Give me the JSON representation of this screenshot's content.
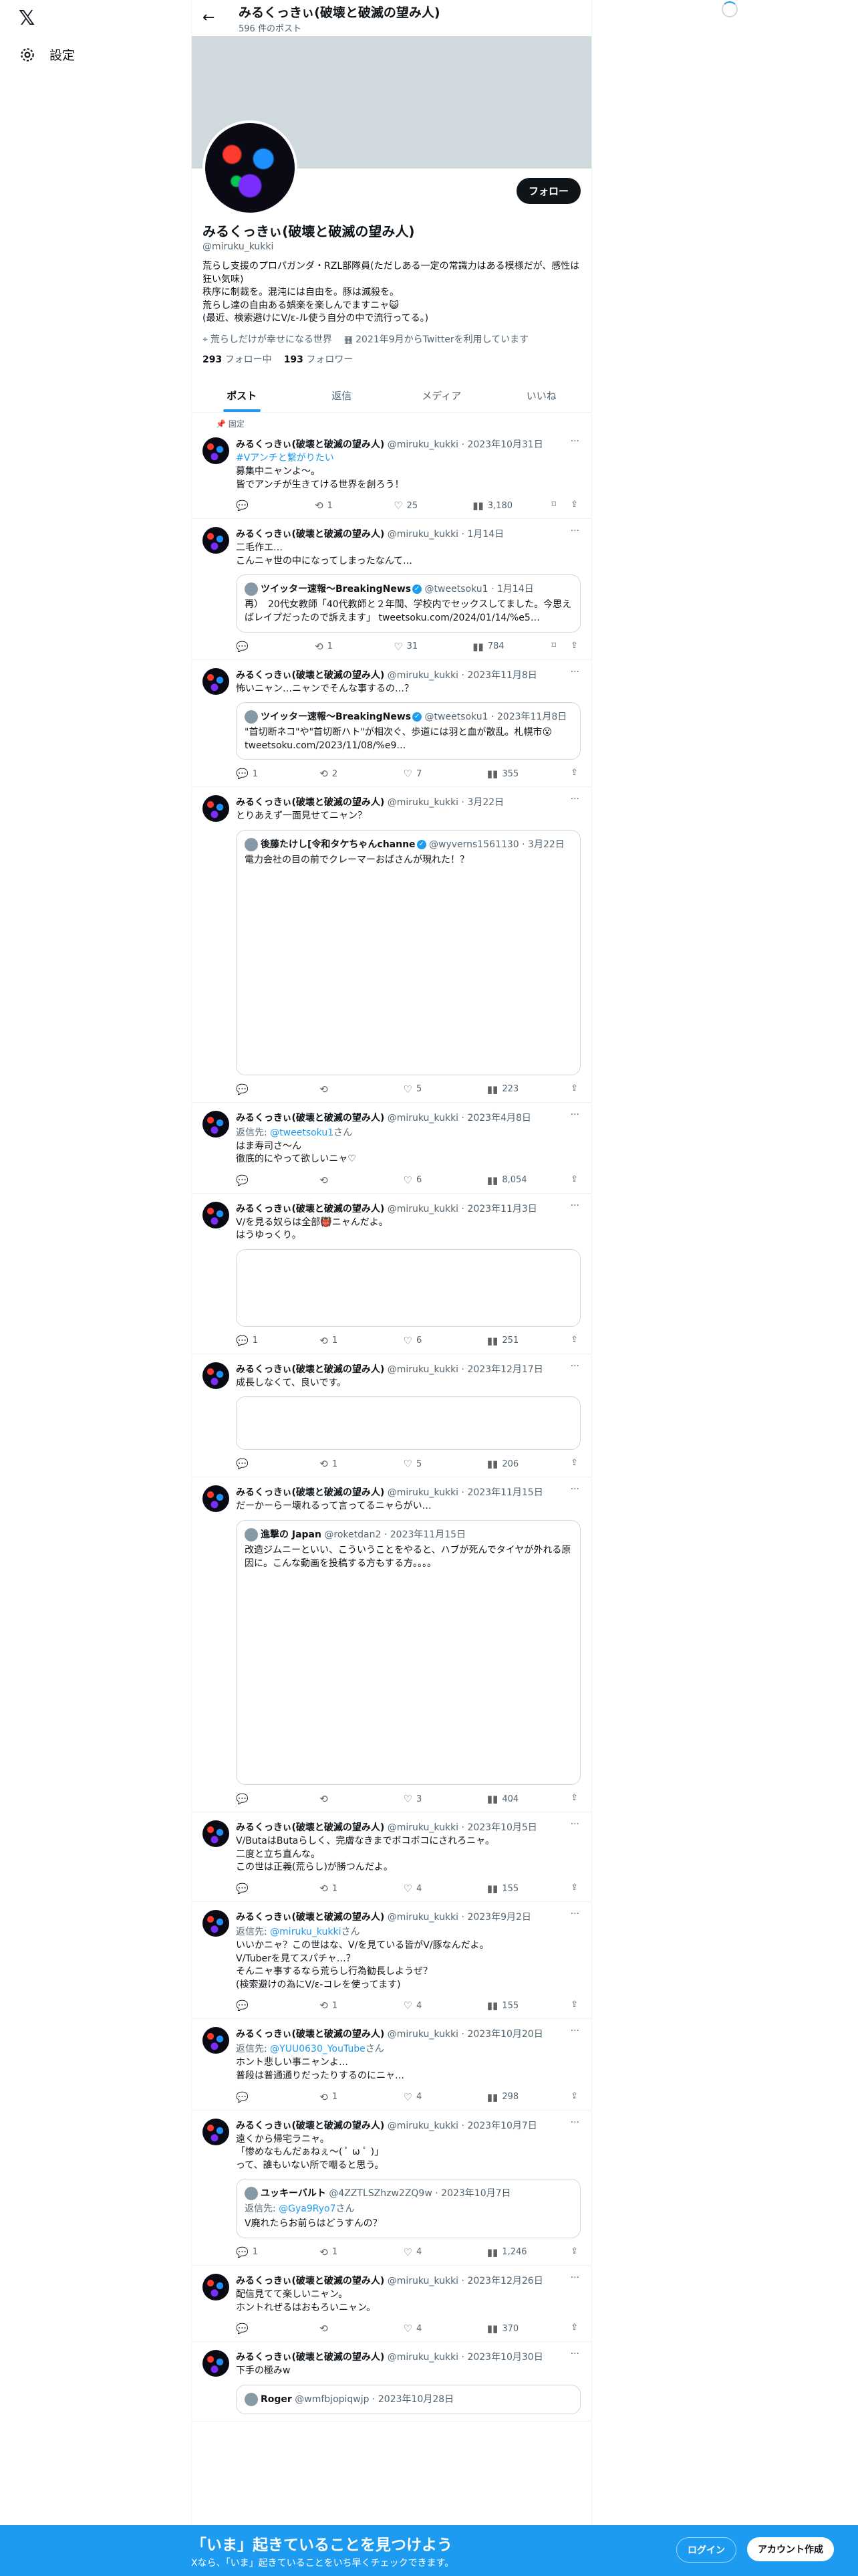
{
  "sidebar": {
    "logo": "𝕏",
    "settings_label": "設定"
  },
  "topbar": {
    "name": "みるくっきぃ(破壊と破滅の望み人)",
    "post_count": "596 件のポスト"
  },
  "profile": {
    "follow_label": "フォロー",
    "name": "みるくっきぃ(破壊と破滅の望み人)",
    "handle": "@miruku_kukki",
    "bio": "荒らし支援のプロパガンダ・RZL部隊員(ただしある一定の常識力はある模様だが、感性は狂い気味)\n秩序に制裁を。混沌には自由を。豚は滅殺を。\n荒らし達の自由ある娯楽を楽しんでますニャ😺\n(最近、検索避けにV/ε-ル使う自分の中で流行ってる。)",
    "location": "荒らしだけが幸せになる世界",
    "joined": "2021年9月からTwitterを利用しています",
    "following_count": "293",
    "following_label": "フォロー中",
    "followers_count": "193",
    "followers_label": "フォロワー"
  },
  "tabs": [
    {
      "label": "ポスト"
    },
    {
      "label": "返信"
    },
    {
      "label": "メディア"
    },
    {
      "label": "いいね"
    }
  ],
  "pinned_label": "固定",
  "author": {
    "name": "みるくっきぃ(破壊と破滅の望み人)",
    "handle": "@miruku_kukki"
  },
  "posts": [
    {
      "date": "2023年10月31日",
      "tag": "#Vアンチと繋がりたい",
      "text": "募集中ニャンよ〜。\n皆でアンチが生きてける世界を創ろう！",
      "replies": "",
      "reposts": "1",
      "likes": "25",
      "views": "3,180"
    },
    {
      "date": "1月14日",
      "text": "二毛作エ…\nこんニャ世の中になってしまったなんて…",
      "quote": {
        "author": "ツイッター速報〜BreakingNews",
        "handle": "@tweetsoku1",
        "date": "1月14日",
        "text": "再）　20代女教師「40代教師と２年間、学校内でセックスしてました。今思えばレイプだったので訴えます」 tweetsoku.com/2024/01/14/%e5…"
      },
      "replies": "",
      "reposts": "1",
      "likes": "31",
      "views": "784"
    },
    {
      "date": "2023年11月8日",
      "text": "怖いニャン…ニャンでそんな事するの…？",
      "quote": {
        "author": "ツイッター速報〜BreakingNews",
        "handle": "@tweetsoku1",
        "date": "2023年11月8日",
        "text": "\"首切断ネコ\"や\"首切断ハト\"が相次ぐ、歩道には羽と血が散乱。札幌市😮 tweetsoku.com/2023/11/08/%e9…"
      },
      "replies": "1",
      "reposts": "2",
      "likes": "7",
      "views": "355"
    },
    {
      "date": "3月22日",
      "text": "とりあえず一面見せてニャン？",
      "quote": {
        "author": "後藤たけし[令和タケちゃんchanne",
        "handle": "@wyverns1561130",
        "date": "3月22日",
        "text": "電力会社の目の前でクレーマーおばさんが現れた！？"
      },
      "replies": "",
      "reposts": "",
      "likes": "5",
      "views": "223"
    },
    {
      "date": "2023年4月8日",
      "reply_prefix": "返信先: ",
      "reply_to": "@tweetsoku1",
      "reply_suffix": "さん",
      "text": "はま寿司さ〜ん\n徹底的にやって欲しいニャ♡",
      "replies": "",
      "reposts": "",
      "likes": "6",
      "views": "8,054"
    },
    {
      "date": "2023年11月3日",
      "text": "V/を見る奴らは全部👹ニャんだよ。\nはうゆっくり。",
      "replies": "1",
      "reposts": "1",
      "likes": "6",
      "views": "251"
    },
    {
      "date": "2023年12月17日",
      "text": "成長しなくて、良いです。",
      "replies": "",
      "reposts": "1",
      "likes": "5",
      "views": "206"
    },
    {
      "date": "2023年11月15日",
      "text": "だーかーらー壊れるって言ってるニャらがい…",
      "quote": {
        "author": "進撃の Japan",
        "handle": "@roketdan2",
        "date": "2023年11月15日",
        "text": "改造ジムニーといい、こういうことをやると、ハブが死んでタイヤが外れる原因に。こんな動画を投稿する方もする方。。。。"
      },
      "replies": "",
      "reposts": "",
      "likes": "3",
      "views": "404"
    },
    {
      "date": "2023年10月5日",
      "text": "V/ButaはButaらしく、完膚なきまでボコボコにされろニャ。\n二度と立ち直んな。\nこの世は正義(荒らし)が勝つんだよ。",
      "replies": "",
      "reposts": "1",
      "likes": "4",
      "views": "155"
    },
    {
      "date": "2023年9月2日",
      "reply_prefix": "返信先: ",
      "reply_to": "@miruku_kukki",
      "reply_suffix": "さん",
      "text": "いいかニャ？この世はな、V/を見ている皆がV/豚なんだよ。\nV/Tuberを見てスパチャ…？\nそんニャ事するなら荒らし行為勧長しようぜ？\n(検索避けの為にV/ε-コレを使ってます)",
      "replies": "",
      "reposts": "1",
      "likes": "4",
      "views": "155"
    },
    {
      "date": "2023年10月20日",
      "reply_prefix": "返信先: ",
      "reply_to": "@YUU0630_YouTube",
      "reply_suffix": "さん",
      "text": "ホント悲しい事ニャンよ…\n普段は普通通りだったりするのにニャ…",
      "replies": "",
      "reposts": "1",
      "likes": "4",
      "views": "298"
    },
    {
      "date": "2023年10月7日",
      "text": "遠くから帰宅ラニャ。\n「惨めなもんだぁねぇ〜( ﾟ ω ﾟ )」\nって、誰もいない所で嘲ると思う。",
      "quote": {
        "author": "ユッキーバルト",
        "handle": "@4ZZTLSZhzw2ZQ9w",
        "date": "2023年10月7日",
        "reply_prefix": "返信先: ",
        "reply_to": "@Gya9Ryo7",
        "reply_suffix": "さん",
        "text": "V廃れたらお前らはどうすんの？"
      },
      "replies": "1",
      "reposts": "1",
      "likes": "4",
      "views": "1,246"
    },
    {
      "date": "2023年12月26日",
      "text": "配信見てて楽しいニャン。\nホントれぜるはおもろいニャン。",
      "replies": "",
      "reposts": "",
      "likes": "4",
      "views": "370"
    },
    {
      "date": "2023年10月30日",
      "text": "下手の極みw",
      "quote": {
        "author": "Roger",
        "handle": "@wmfbjopiqwjp",
        "date": "2023年10月28日",
        "text": ""
      }
    }
  ],
  "bottom_bar": {
    "title": "「いま」起きていることを見つけよう",
    "subtitle": "Xなら、「いま」起きていることをいち早くチェックできます。",
    "login_label": "ログイン",
    "signup_label": "アカウント作成"
  },
  "colors": {
    "accent": "#1d9bf0",
    "text": "#0f1419",
    "muted": "#536471",
    "banner": "#cfd9de"
  }
}
